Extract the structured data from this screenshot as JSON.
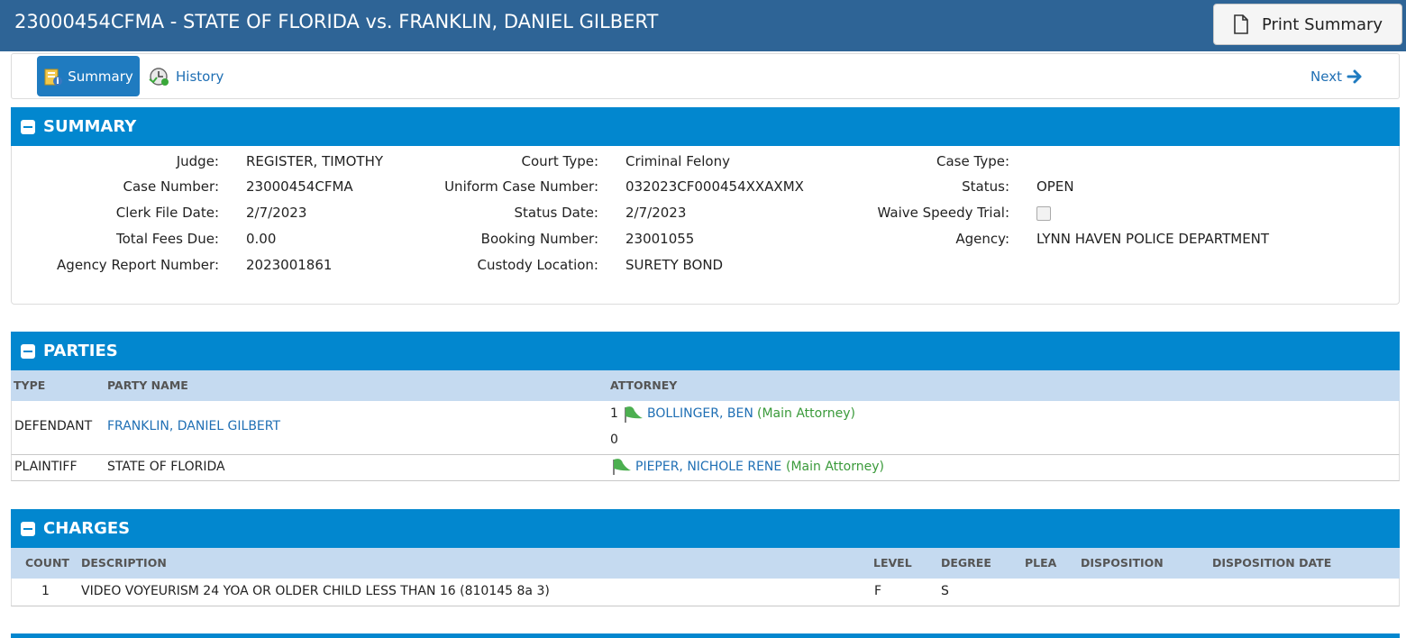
{
  "header": {
    "title": "23000454CFMA - STATE OF FLORIDA vs. FRANKLIN, DANIEL GILBERT",
    "print_label": "Print Summary"
  },
  "nav": {
    "summary_label": "Summary",
    "history_label": "History",
    "next_label": "Next"
  },
  "summary": {
    "heading": "SUMMARY",
    "labels": {
      "judge": "Judge:",
      "case_number": "Case Number:",
      "clerk_file_date": "Clerk File Date:",
      "total_fees_due": "Total Fees Due:",
      "agency_report_number": "Agency Report Number:",
      "court_type": "Court Type:",
      "uniform_case_number": "Uniform Case Number:",
      "status_date": "Status Date:",
      "booking_number": "Booking Number:",
      "custody_location": "Custody Location:",
      "case_type": "Case Type:",
      "status": "Status:",
      "waive_speedy_trial": "Waive Speedy Trial:",
      "agency": "Agency:"
    },
    "values": {
      "judge": "REGISTER, TIMOTHY",
      "case_number": "23000454CFMA",
      "clerk_file_date": "2/7/2023",
      "total_fees_due": "0.00",
      "agency_report_number": "2023001861",
      "court_type": "Criminal Felony",
      "uniform_case_number": "032023CF000454XXAXMX",
      "status_date": "2/7/2023",
      "booking_number": "23001055",
      "custody_location": "SURETY BOND",
      "case_type": "",
      "status": "OPEN",
      "waive_speedy_trial": false,
      "agency": "LYNN HAVEN POLICE DEPARTMENT"
    }
  },
  "parties": {
    "heading": "PARTIES",
    "columns": {
      "type": "TYPE",
      "party_name": "PARTY NAME",
      "attorney": "ATTORNEY"
    },
    "rows": [
      {
        "type": "DEFENDANT",
        "party_name": "FRANKLIN, DANIEL GILBERT",
        "attorney_prefix": "1",
        "attorney": "BOLLINGER, BEN",
        "attorney_role": "(Main Attorney)",
        "extra": "0"
      },
      {
        "type": "PLAINTIFF",
        "party_name": "STATE OF FLORIDA",
        "attorney": "PIEPER, NICHOLE RENE",
        "attorney_role": "(Main Attorney)"
      }
    ]
  },
  "charges": {
    "heading": "CHARGES",
    "columns": {
      "count": "COUNT",
      "description": "DESCRIPTION",
      "level": "LEVEL",
      "degree": "DEGREE",
      "plea": "PLEA",
      "disposition": "DISPOSITION",
      "disposition_date": "DISPOSITION DATE"
    },
    "rows": [
      {
        "count": "1",
        "description": "VIDEO VOYEURISM 24 YOA OR OLDER CHILD LESS THAN 16 (810145 8a 3)",
        "level": "F",
        "degree": "S",
        "plea": "",
        "disposition": "",
        "disposition_date": ""
      }
    ]
  },
  "colors": {
    "title_bar": "#2e6496",
    "panel_header": "#0287cf",
    "table_header": "#c5daf0",
    "link": "#1f6fb4",
    "main_attorney": "#3a9a3a"
  }
}
